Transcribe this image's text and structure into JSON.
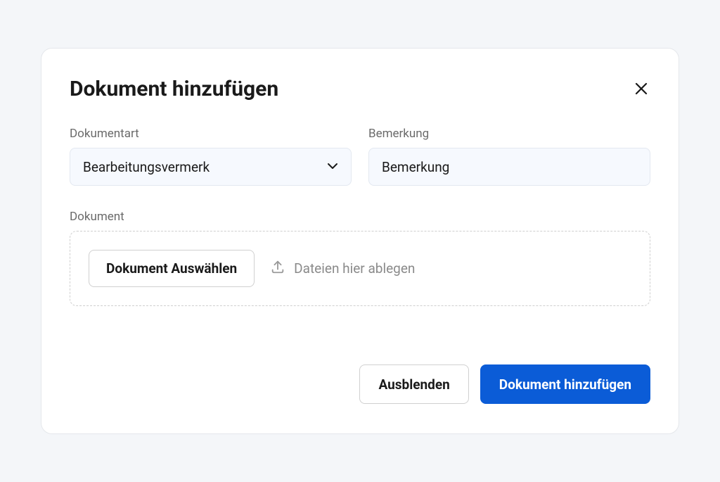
{
  "modal": {
    "title": "Dokument hinzufügen"
  },
  "form": {
    "document_type": {
      "label": "Dokumentart",
      "selected": "Bearbeitungsvermerk"
    },
    "remark": {
      "label": "Bemerkung",
      "placeholder": "Bemerkung"
    },
    "document": {
      "label": "Dokument",
      "choose_button": "Dokument Auswählen",
      "drop_hint": "Dateien hier ablegen"
    }
  },
  "footer": {
    "cancel": "Ausblenden",
    "submit": "Dokument hinzufügen"
  }
}
